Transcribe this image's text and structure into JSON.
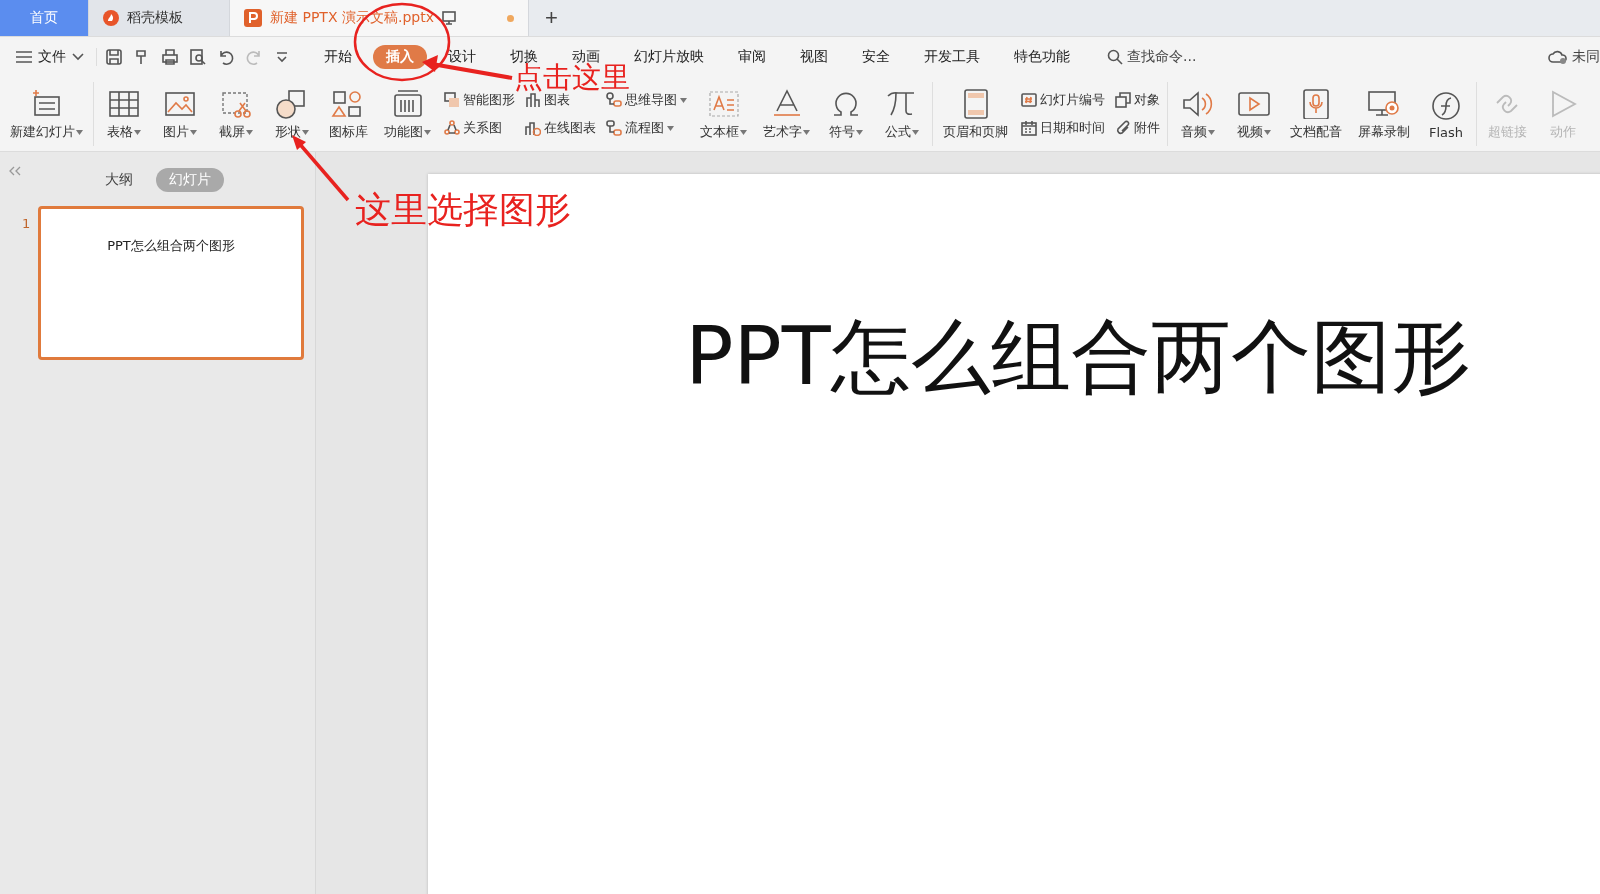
{
  "tabs": [
    {
      "label": "首页",
      "kind": "home",
      "selected": false
    },
    {
      "label": "稻壳模板",
      "kind": "docer",
      "selected": false
    },
    {
      "label": "新建 PPTX 演示文稿.pptx",
      "kind": "doc",
      "selected": true,
      "unsaved": true
    }
  ],
  "new_tab": "+",
  "menu": {
    "file": "文件",
    "tabs": [
      {
        "label": "开始",
        "selected": false
      },
      {
        "label": "插入",
        "selected": true
      },
      {
        "label": "设计",
        "selected": false
      },
      {
        "label": "切换",
        "selected": false
      },
      {
        "label": "动画",
        "selected": false
      },
      {
        "label": "幻灯片放映",
        "selected": false
      },
      {
        "label": "审阅",
        "selected": false
      },
      {
        "label": "视图",
        "selected": false
      },
      {
        "label": "安全",
        "selected": false
      },
      {
        "label": "开发工具",
        "selected": false
      },
      {
        "label": "特色功能",
        "selected": false
      }
    ],
    "search_placeholder": "查找命令...",
    "sync": "未同"
  },
  "ribbon": [
    {
      "items": [
        {
          "kind": "large",
          "label": "新建幻灯片",
          "dropdown": true,
          "disabled": false
        }
      ]
    },
    {
      "items": [
        {
          "kind": "large",
          "label": "表格",
          "dropdown": true,
          "disabled": false
        },
        {
          "kind": "large",
          "label": "图片",
          "dropdown": true,
          "disabled": false
        },
        {
          "kind": "large",
          "label": "截屏",
          "dropdown": true,
          "disabled": false
        },
        {
          "kind": "large",
          "label": "形状",
          "dropdown": true,
          "disabled": false
        },
        {
          "kind": "large",
          "label": "图标库",
          "dropdown": false,
          "disabled": false
        },
        {
          "kind": "large",
          "label": "功能图",
          "dropdown": true,
          "disabled": false
        },
        {
          "kind": "stack",
          "items": [
            {
              "label": "智能图形",
              "dropdown": false
            },
            {
              "label": "关系图",
              "dropdown": false
            }
          ]
        },
        {
          "kind": "stack",
          "items": [
            {
              "label": "图表",
              "dropdown": false
            },
            {
              "label": "在线图表",
              "dropdown": false
            }
          ]
        },
        {
          "kind": "stack",
          "items": [
            {
              "label": "思维导图",
              "dropdown": true
            },
            {
              "label": "流程图",
              "dropdown": true
            }
          ]
        },
        {
          "kind": "large",
          "label": "文本框",
          "dropdown": true,
          "disabled": false
        },
        {
          "kind": "large",
          "label": "艺术字",
          "dropdown": true,
          "disabled": false
        },
        {
          "kind": "large",
          "label": "符号",
          "dropdown": true,
          "disabled": false
        },
        {
          "kind": "large",
          "label": "公式",
          "dropdown": true,
          "disabled": false
        }
      ]
    },
    {
      "items": [
        {
          "kind": "large",
          "label": "页眉和页脚",
          "dropdown": false,
          "disabled": false
        },
        {
          "kind": "stack",
          "items": [
            {
              "label": "幻灯片编号",
              "dropdown": false
            },
            {
              "label": "日期和时间",
              "dropdown": false
            }
          ]
        },
        {
          "kind": "stack",
          "items": [
            {
              "label": "对象",
              "dropdown": false
            },
            {
              "label": "附件",
              "dropdown": false
            }
          ]
        }
      ]
    },
    {
      "items": [
        {
          "kind": "large",
          "label": "音频",
          "dropdown": true,
          "disabled": false
        },
        {
          "kind": "large",
          "label": "视频",
          "dropdown": true,
          "disabled": false
        },
        {
          "kind": "large",
          "label": "文档配音",
          "dropdown": false,
          "disabled": false
        },
        {
          "kind": "large",
          "label": "屏幕录制",
          "dropdown": false,
          "disabled": false
        },
        {
          "kind": "large",
          "label": "Flash",
          "dropdown": false,
          "disabled": false
        }
      ]
    },
    {
      "items": [
        {
          "kind": "large",
          "label": "超链接",
          "dropdown": false,
          "disabled": true
        },
        {
          "kind": "large",
          "label": "动作",
          "dropdown": false,
          "disabled": true
        }
      ]
    }
  ],
  "side_panel": {
    "tabs": [
      {
        "label": "大纲",
        "selected": false
      },
      {
        "label": "幻灯片",
        "selected": true
      }
    ],
    "slides": [
      {
        "number": "1",
        "title": "PPT怎么组合两个图形",
        "selected": true
      }
    ]
  },
  "slide": {
    "title": "PPT怎么组合两个图形"
  },
  "annotations": [
    {
      "kind": "circle"
    },
    {
      "kind": "callout",
      "text": "点击这里"
    },
    {
      "kind": "callout",
      "text": "这里选择图形"
    }
  ]
}
